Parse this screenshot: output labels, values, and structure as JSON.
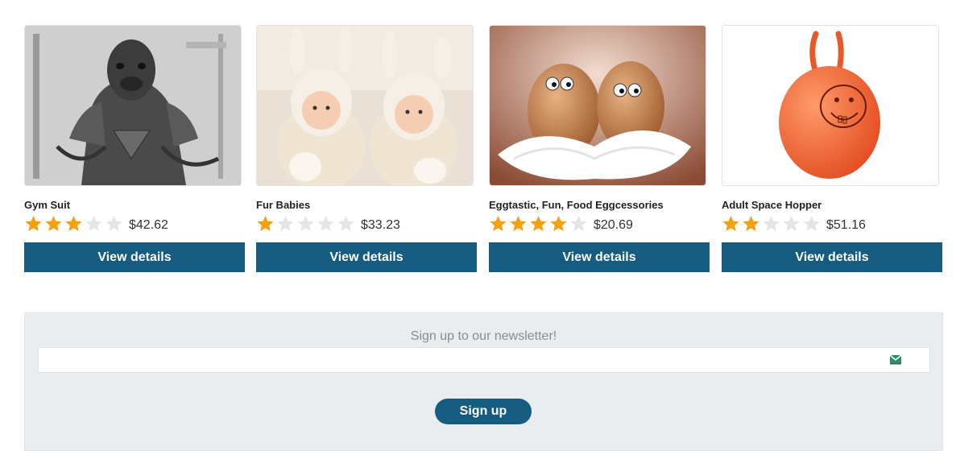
{
  "products": [
    {
      "title": "Gym Suit",
      "rating": 3,
      "max_rating": 5,
      "price": "$42.62",
      "button": "View details",
      "image": "dog-bodybuilder-photo"
    },
    {
      "title": "Fur Babies",
      "rating": 1,
      "max_rating": 5,
      "price": "$33.23",
      "button": "View details",
      "image": "babies-bunny-hats-photo"
    },
    {
      "title": "Eggtastic, Fun, Food Eggcessories",
      "rating": 4,
      "max_rating": 5,
      "price": "$20.69",
      "button": "View details",
      "image": "eggs-with-eyes-photo"
    },
    {
      "title": "Adult Space Hopper",
      "rating": 2,
      "max_rating": 5,
      "price": "$51.16",
      "button": "View details",
      "image": "orange-space-hopper-photo"
    }
  ],
  "newsletter": {
    "title": "Sign up to our newsletter!",
    "input_value": "",
    "button": "Sign up",
    "icon": "mail-icon"
  },
  "colors": {
    "button": "#155c80",
    "star_filled": "#f5a00f",
    "star_empty": "#e5e5e5",
    "newsletter_bg": "#e9edf0"
  }
}
